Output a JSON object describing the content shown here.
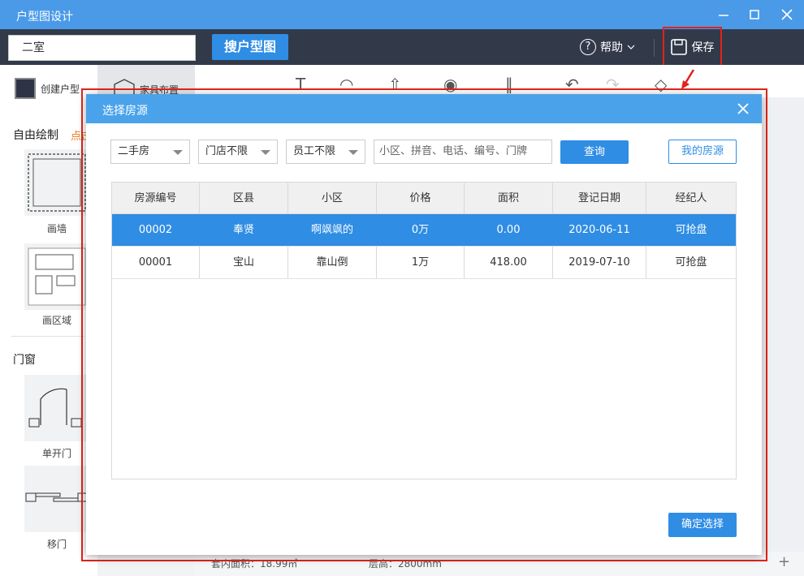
{
  "app": {
    "title": "户型图设计"
  },
  "topbar": {
    "search_value": "二室",
    "search_button": "搜户型图",
    "help_label": "帮助",
    "save_label": "保存"
  },
  "left": {
    "create_label": "创建户型",
    "furniture_label": "家具布置",
    "free_draw": "自由绘制",
    "hint": "点击",
    "draw_wall": "画墙",
    "draw_area": "画区域",
    "doors_windows": "门窗",
    "single_door": "单开门",
    "sliding_door": "移门"
  },
  "bottom": {
    "inner_area": "套内面积：18.99㎡",
    "floor_height": "层高：2800mm"
  },
  "modal": {
    "title": "选择房源",
    "filters": {
      "type": "二手房",
      "store": "门店不限",
      "staff": "员工不限",
      "keyword_placeholder": "小区、拼音、电话、编号、门牌"
    },
    "query_button": "查询",
    "my_listings_button": "我的房源",
    "confirm_button": "确定选择",
    "columns": [
      "房源编号",
      "区县",
      "小区",
      "价格",
      "面积",
      "登记日期",
      "经纪人"
    ],
    "rows": [
      [
        "00002",
        "奉贤",
        "啊飒飒的",
        "0万",
        "0.00",
        "2020-06-11",
        "可抢盘"
      ],
      [
        "00001",
        "宝山",
        "靠山倒",
        "1万",
        "418.00",
        "2019-07-10",
        "可抢盘"
      ]
    ],
    "selected_row": 0
  },
  "colors": {
    "titlebar": "#4a9ae8",
    "topbar": "#323a4a",
    "accent": "#2f8de4",
    "highlight": "#e2231a"
  }
}
